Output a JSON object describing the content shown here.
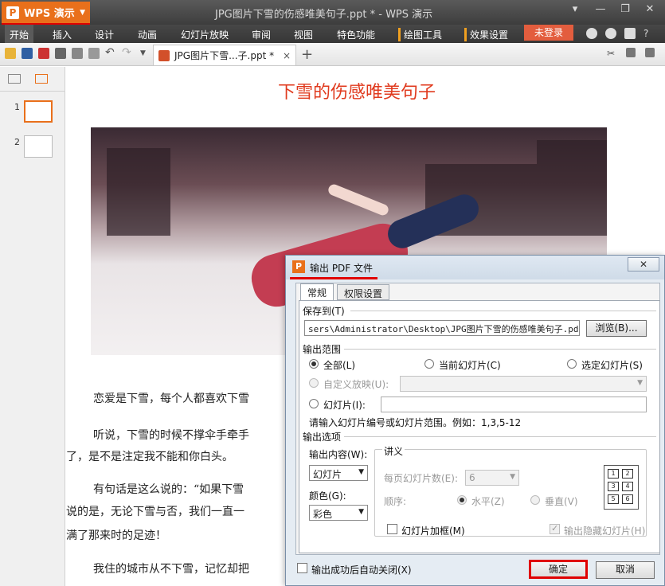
{
  "app": {
    "name": "WPS 演示",
    "logo_letter": "P",
    "window_title": "JPG图片下雪的伤感唯美句子.ppt * - WPS 演示"
  },
  "window_controls": {
    "help": "?",
    "minimize": "—",
    "restore": "❐",
    "close": "✕"
  },
  "menu": {
    "items": [
      "开始",
      "插入",
      "设计",
      "动画",
      "幻灯片放映",
      "审阅",
      "视图",
      "特色功能"
    ],
    "context_tabs": [
      "绘图工具",
      "效果设置"
    ],
    "login": "未登录"
  },
  "document_tab": {
    "name": "JPG图片下雪...子.ppt *",
    "close": "×",
    "new_tab": "+"
  },
  "left_panel": {
    "thumbnails": [
      "1",
      "2"
    ]
  },
  "slide": {
    "title": "下雪的伤感唯美句子",
    "paragraphs": [
      "恋爱是下雪，每个人都喜欢下雪",
      "听说，下雪的时候不撑伞手牵手",
      "了，是不是注定我不能和你白头。",
      "有句话是这么说的：“如果下雪",
      "说的是，无论下雪与否，我们一直一",
      "满了那来时的足迹！",
      "我住的城市从不下雪，记忆却把"
    ]
  },
  "dialog": {
    "title": "输出 PDF 文件",
    "close": "✕",
    "tabs": [
      "常规",
      "权限设置"
    ],
    "save_to_label": "保存到(T)",
    "save_path": "sers\\Administrator\\Desktop\\JPG图片下雪的伤感唯美句子.pdf",
    "browse": "浏览(B)...",
    "range_label": "输出范围",
    "range_all": "全部(L)",
    "range_current": "当前幻灯片(C)",
    "range_selected": "选定幻灯片(S)",
    "range_custom": "自定义放映(U):",
    "range_slides": "幻灯片(I):",
    "range_hint": "请输入幻灯片编号或幻灯片范围。例如：1,3,5-12",
    "options_label": "输出选项",
    "content_label": "输出内容(W):",
    "content_value": "幻灯片",
    "color_label": "颜色(G):",
    "color_value": "彩色",
    "handout_label": "讲义",
    "per_page_label": "每页幻灯片数(E):",
    "per_page_value": "6",
    "order_label": "顺序:",
    "order_horizontal": "水平(Z)",
    "order_vertical": "垂直(V)",
    "frame_checkbox": "幻灯片加框(M)",
    "hidden_checkbox": "输出隐藏幻灯片(H)",
    "auto_close": "输出成功后自动关闭(X)",
    "ok": "确定",
    "cancel": "取消",
    "layout_cells": [
      "1",
      "2",
      "3",
      "4",
      "5",
      "6"
    ]
  }
}
